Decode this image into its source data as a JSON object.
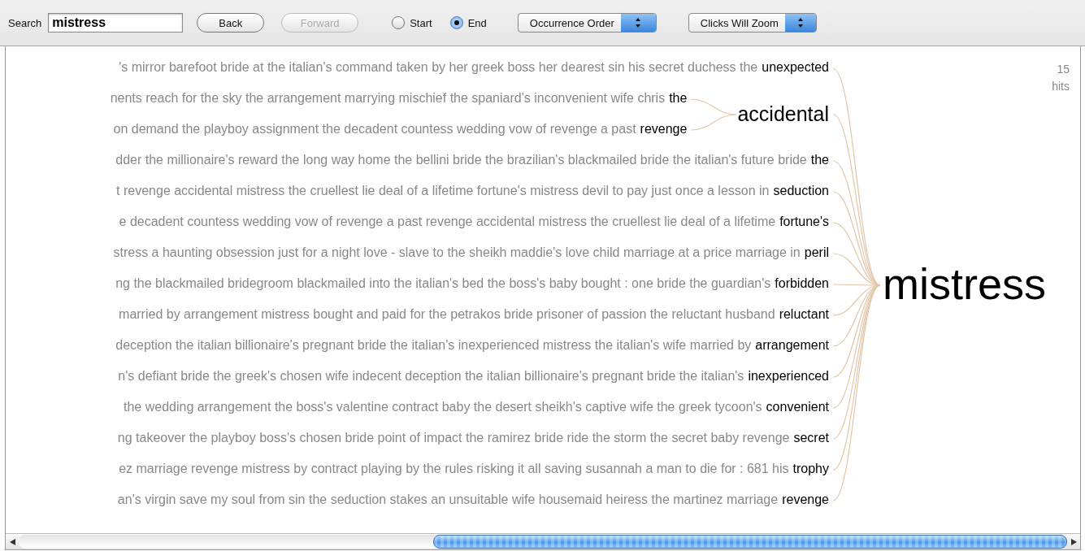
{
  "toolbar": {
    "search_label": "Search",
    "search_value": "mistress",
    "buttons": [
      {
        "label": "Back",
        "disabled": false
      },
      {
        "label": "Forward",
        "disabled": true
      }
    ],
    "radios": [
      {
        "label": "Start",
        "selected": false
      },
      {
        "label": "End",
        "selected": true
      }
    ],
    "selects": [
      {
        "value": "Occurrence Order"
      },
      {
        "value": "Clicks Will Zoom"
      }
    ]
  },
  "tree": {
    "root": "mistress",
    "hits": {
      "count": "15",
      "label": "hits"
    },
    "branches": [
      {
        "context": "'s mirror barefoot bride at the italian's command taken by her greek boss her dearest sin his secret duchess the",
        "word": "unexpected"
      },
      {
        "word": "accidental",
        "children": [
          {
            "context": "nents reach for the sky the arrangement marrying mischief the spaniard's inconvenient wife chris",
            "word": "the"
          },
          {
            "context": "on demand the playboy assignment the decadent countess wedding vow of revenge a past",
            "word": "revenge"
          }
        ]
      },
      {
        "context": "dder the millionaire's reward the long way home the bellini bride the brazilian's blackmailed bride the italian's future bride",
        "word": "the"
      },
      {
        "context": "t revenge accidental mistress the cruellest lie deal of a lifetime fortune's mistress devil to pay just once a lesson in",
        "word": "seduction"
      },
      {
        "context": "e decadent countess wedding vow of revenge a past revenge accidental mistress the cruellest lie deal of a lifetime",
        "word": "fortune's"
      },
      {
        "context": "stress a haunting obsession just for a night love - slave to the sheikh maddie's love child marriage at a price marriage in",
        "word": "peril"
      },
      {
        "context": "ng the blackmailed bridegroom blackmailed into the italian's bed the boss's baby bought : one bride the guardian's",
        "word": "forbidden"
      },
      {
        "context": "married by arrangement mistress bought and paid for the petrakos bride prisoner of passion the reluctant husband",
        "word": "reluctant"
      },
      {
        "context": "deception the italian billionaire's pregnant bride the italian's inexperienced mistress the italian's wife married by",
        "word": "arrangement"
      },
      {
        "context": "n's defiant bride the greek's chosen wife indecent deception the italian billionaire's pregnant bride the italian's",
        "word": "inexperienced"
      },
      {
        "context": "the wedding arrangement the boss's valentine contract baby the desert sheikh's captive wife the greek tycoon's",
        "word": "convenient"
      },
      {
        "context": "ng takeover the playboy boss's chosen bride point of impact the ramirez bride ride the storm the secret baby revenge",
        "word": "secret"
      },
      {
        "context": "ez marriage revenge mistress by contract playing by the rules risking it all saving susannah a man to die for : 681 his",
        "word": "trophy"
      },
      {
        "context": "an's virgin save my soul from sin the seduction stakes an unsuitable wife housemaid heiress the martinez marriage",
        "word": "revenge"
      }
    ]
  }
}
